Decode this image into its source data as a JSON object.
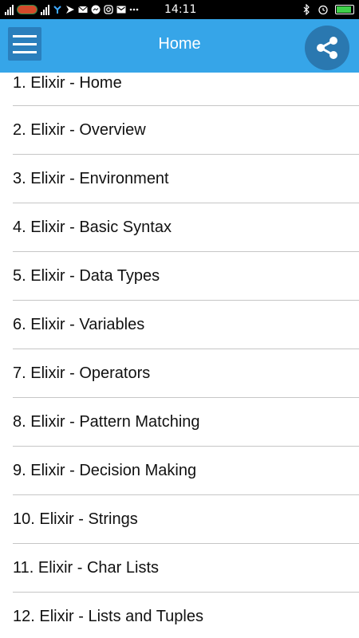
{
  "status_bar": {
    "time": "14:11",
    "carrier_logo": "carrier-logo",
    "icons_left": [
      "signal-icon",
      "signal-icon",
      "network-icon",
      "flag-icon",
      "mail-icon",
      "messenger-icon",
      "instagram-icon",
      "gmail-icon",
      "more-icon"
    ],
    "icons_right": [
      "bluetooth-icon",
      "alarm-icon",
      "battery-icon"
    ],
    "battery_level": 0.9
  },
  "app_bar": {
    "title": "Home",
    "background": "#36a5e8"
  },
  "list": {
    "items": [
      {
        "label": "1. Elixir - Home"
      },
      {
        "label": "2. Elixir - Overview"
      },
      {
        "label": "3. Elixir - Environment"
      },
      {
        "label": "4. Elixir - Basic Syntax"
      },
      {
        "label": "5. Elixir - Data Types"
      },
      {
        "label": "6. Elixir - Variables"
      },
      {
        "label": "7. Elixir - Operators"
      },
      {
        "label": "8. Elixir - Pattern Matching"
      },
      {
        "label": "9. Elixir - Decision Making"
      },
      {
        "label": "10. Elixir - Strings"
      },
      {
        "label": "11. Elixir - Char Lists"
      },
      {
        "label": "12. Elixir - Lists and Tuples"
      }
    ]
  }
}
